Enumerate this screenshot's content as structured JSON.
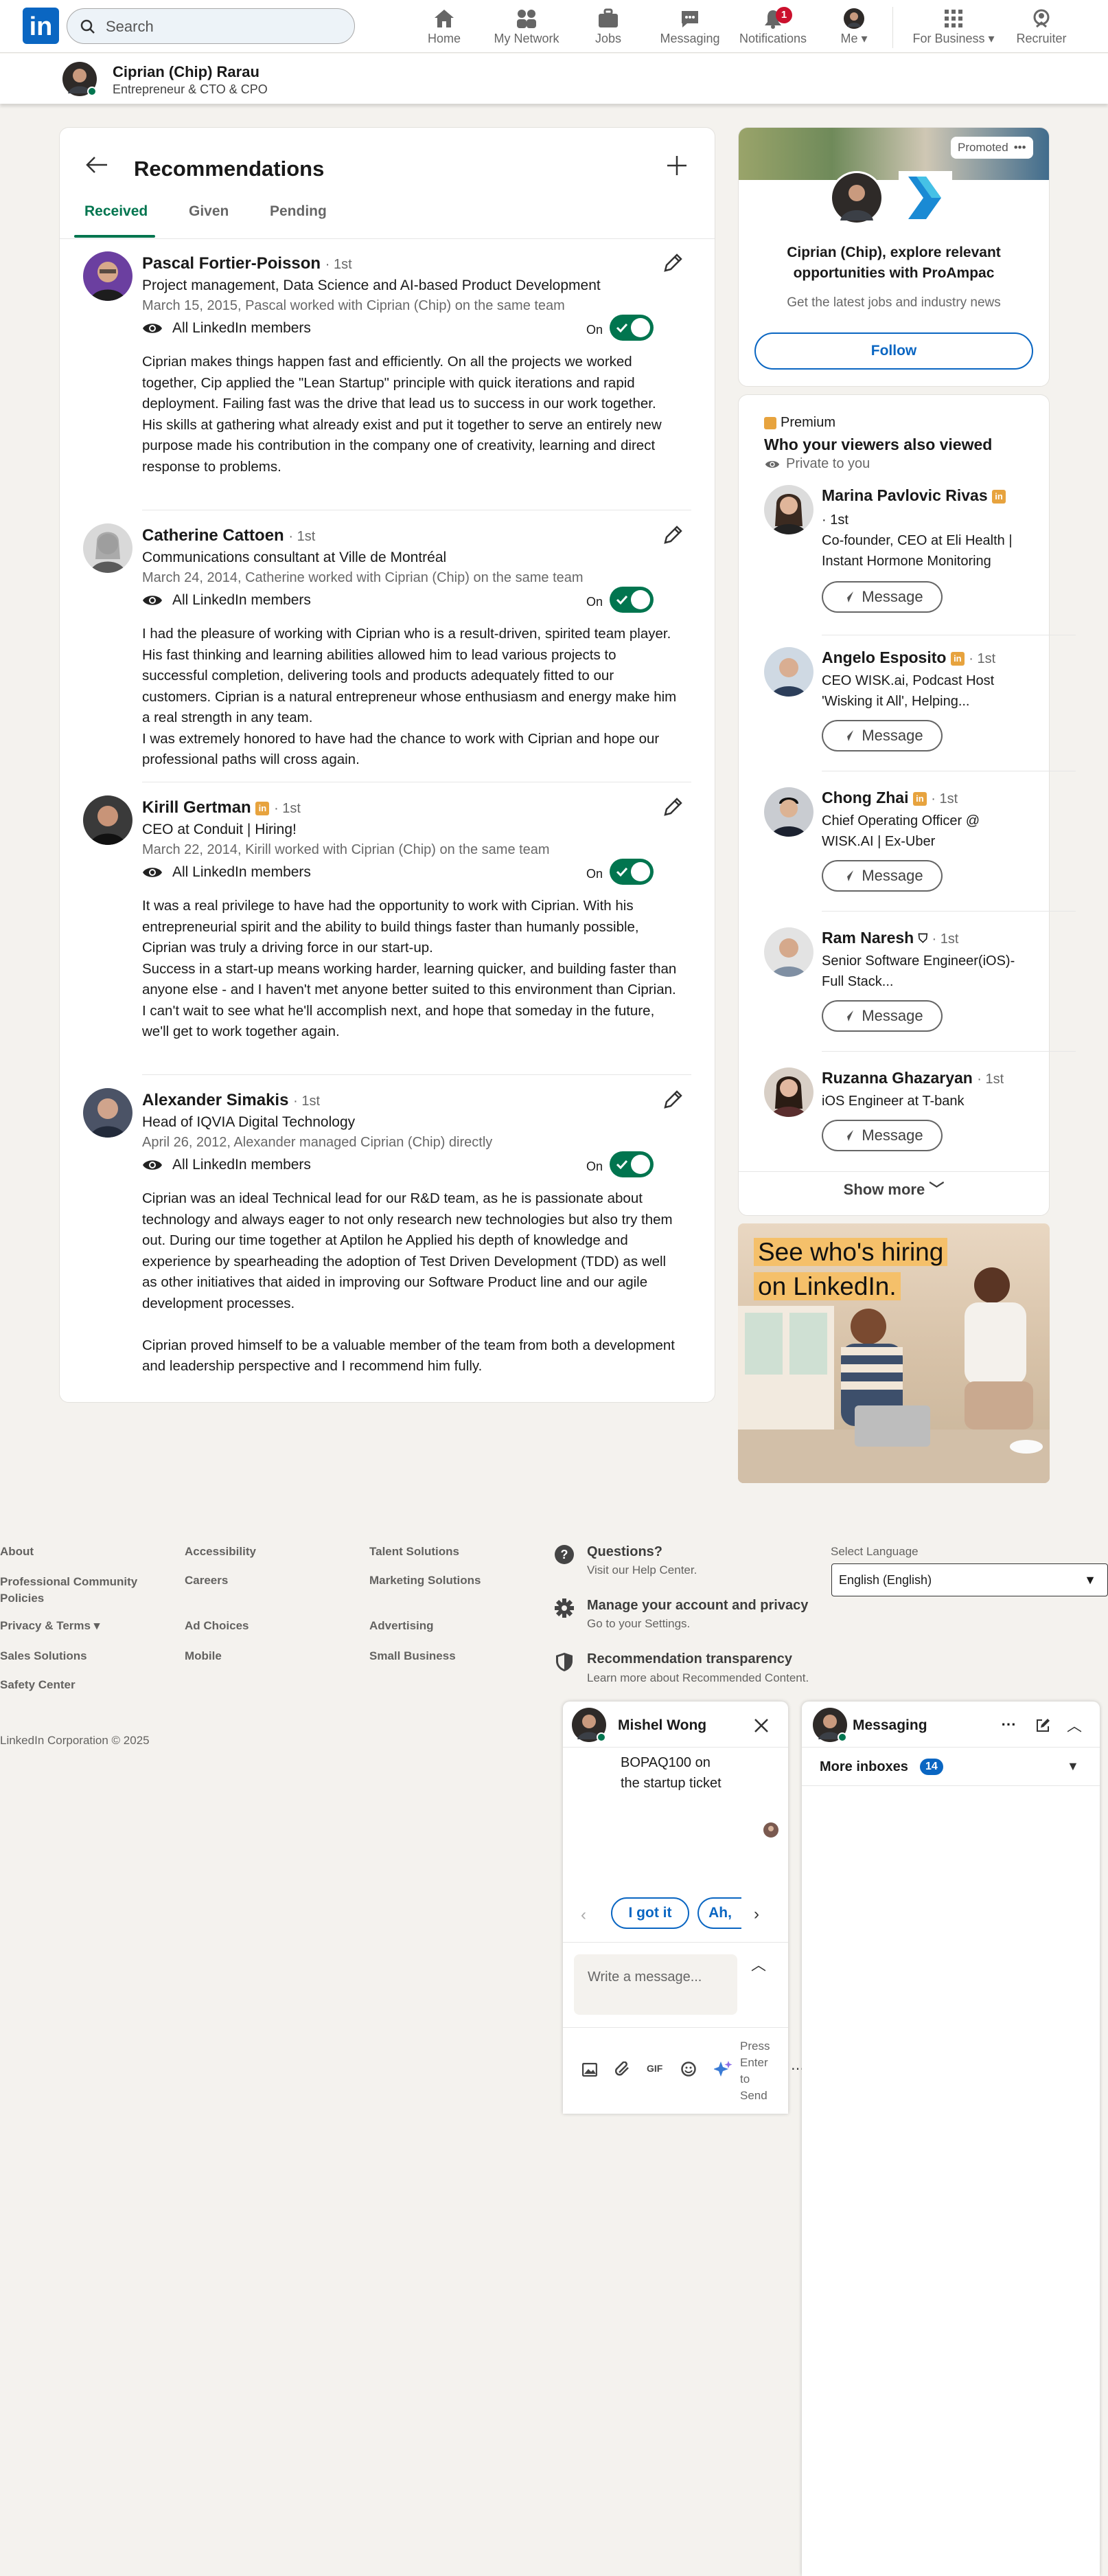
{
  "nav": {
    "search_placeholder": "Search",
    "items": [
      {
        "label": "Home",
        "icon": "home-icon"
      },
      {
        "label": "My Network",
        "icon": "network-icon"
      },
      {
        "label": "Jobs",
        "icon": "jobs-icon"
      },
      {
        "label": "Messaging",
        "icon": "messaging-icon"
      },
      {
        "label": "Notifications",
        "icon": "bell-icon",
        "badge": "1"
      },
      {
        "label": "Me",
        "icon": "avatar"
      },
      {
        "label": "For Business",
        "icon": "grid-icon"
      },
      {
        "label": "Recruiter",
        "icon": "recruiter-icon"
      }
    ]
  },
  "profile": {
    "name": "Ciprian (Chip) Rarau",
    "headline": "Entrepreneur & CTO & CPO"
  },
  "recommendations": {
    "title": "Recommendations",
    "tabs": [
      "Received",
      "Given",
      "Pending"
    ],
    "visibility_label": "All LinkedIn members",
    "toggle_label": "On",
    "items": [
      {
        "name": "Pascal Fortier-Poisson",
        "degree": "· 1st",
        "title": "Project management, Data Science and AI-based Product Development",
        "date": "March 15, 2015, Pascal worked with Ciprian (Chip) on the same team",
        "text": "Ciprian makes things happen fast and efficiently. On all the projects we worked together, Cip applied the \"Lean Startup\" principle with quick iterations and rapid deployment. Failing fast was the drive that lead us to success in our work together.\nHis skills at gathering what already exist and put it together to serve an entirely new purpose made his contribution in the company one of creativity, learning and direct response to problems."
      },
      {
        "name": "Catherine Cattoen",
        "degree": "· 1st",
        "title": "Communications consultant at Ville de Montréal",
        "date": "March 24, 2014, Catherine worked with Ciprian (Chip) on the same team",
        "text": "I had the pleasure of working with Ciprian who is a result-driven, spirited team player. His fast thinking and learning abilities allowed him to lead various projects to successful completion, delivering tools and products adequately fitted to our customers. Ciprian is a natural entrepreneur whose enthusiasm and energy make him a real strength in any team.\nI was extremely honored to have had the chance to work with Ciprian and hope our professional paths will cross again."
      },
      {
        "name": "Kirill Gertman",
        "degree": "· 1st",
        "title": "CEO at Conduit | Hiring!",
        "date": "March 22, 2014, Kirill worked with Ciprian (Chip) on the same team",
        "text": "It was a real privilege to have had the opportunity to work with Ciprian. With his entrepreneurial spirit and the ability to build things faster than humanly possible, Ciprian was truly a driving force in our start-up.\nSuccess in a start-up means working harder, learning quicker, and building faster than anyone else - and I haven't met anyone better suited to this environment than Ciprian.\nI can't wait to see what he'll accomplish next, and hope that someday in the future, we'll get to work together again."
      },
      {
        "name": "Alexander Simakis",
        "degree": "· 1st",
        "title": "Head of IQVIA Digital Technology",
        "date": "April 26, 2012, Alexander managed Ciprian (Chip) directly",
        "text": "Ciprian was an ideal Technical lead for our R&D team, as he is passionate about technology and always eager to not only research new technologies but also try them out. During our time together at Aptilon he Applied his depth of knowledge and experience by spearheading the adoption of Test Driven Development (TDD) as well as other initiatives that aided in improving our Software Product line and our agile development processes.\n\nCiprian proved himself to be a valuable member of the team from both a development and leadership perspective and I recommend him fully."
      }
    ]
  },
  "promo": {
    "promoted": "Promoted",
    "text": "Ciprian (Chip), explore relevant opportunities with ProAmpac",
    "sub": "Get the latest jobs and industry news",
    "follow": "Follow"
  },
  "viewers": {
    "premium": "Premium",
    "title": "Who your viewers also viewed",
    "private": "Private to you",
    "message_label": "Message",
    "people": [
      {
        "name": "Marina Pavlovic Rivas",
        "degree": "· 1st",
        "desc": "Co-founder, CEO at Eli Health | Instant Hormone Monitoring"
      },
      {
        "name": "Angelo Esposito",
        "degree": "· 1st",
        "desc": "CEO WISK.ai, Podcast Host 'Wisking it All', Helping..."
      },
      {
        "name": "Chong Zhai",
        "degree": "· 1st",
        "desc": "Chief Operating Officer @ WISK.AI | Ex-Uber"
      },
      {
        "name": "Ram Naresh",
        "degree": "· 1st",
        "desc": "Senior Software Engineer(iOS)- Full Stack..."
      },
      {
        "name": "Ruzanna Ghazaryan",
        "degree": "· 1st",
        "desc": "iOS Engineer at T-bank"
      }
    ],
    "show_more": "Show more"
  },
  "ad": {
    "line1": "See who's hiring",
    "line2": "on LinkedIn."
  },
  "footer": {
    "col1": [
      "About",
      "Professional Community Policies",
      "Privacy & Terms",
      "Sales Solutions",
      "Safety Center"
    ],
    "col2": [
      "Accessibility",
      "Careers",
      "Ad Choices",
      "Mobile"
    ],
    "col3": [
      "Talent Solutions",
      "Marketing Solutions",
      "Advertising",
      "Small Business"
    ],
    "help": [
      {
        "title": "Questions?",
        "sub": "Visit our Help Center."
      },
      {
        "title": "Manage your account and privacy",
        "sub": "Go to your Settings."
      },
      {
        "title": "Recommendation transparency",
        "sub": "Learn more about Recommended Content."
      }
    ],
    "language_label": "Select Language",
    "language_value": "English (English)",
    "copyright": "LinkedIn Corporation © 2025"
  },
  "chat": {
    "name": "Mishel Wong",
    "message": "BOPAQ100 on the startup ticket",
    "chips": [
      "I got it",
      "Ah,"
    ],
    "input_placeholder": "Write a message...",
    "send_hint": "Press Enter to Send"
  },
  "messaging": {
    "title": "Messaging",
    "more_inboxes": "More inboxes",
    "count": "14"
  },
  "colors": {
    "brand": "#0a66c2",
    "accent": "#01754f",
    "premium": "#e7a33e"
  }
}
